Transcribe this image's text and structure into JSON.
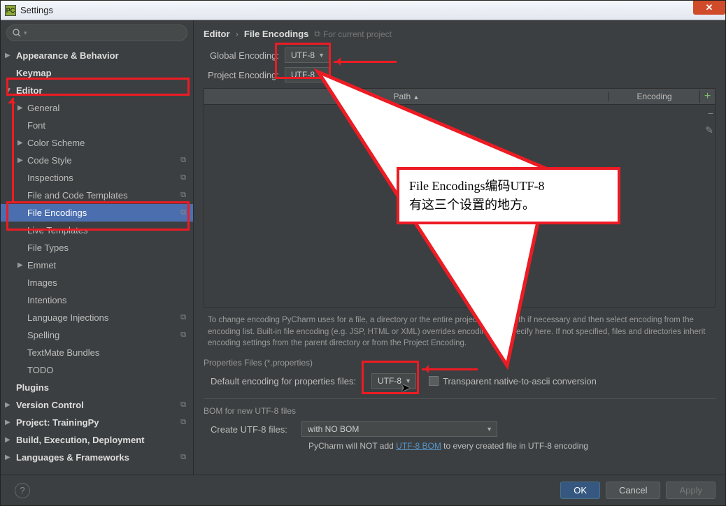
{
  "window": {
    "title": "Settings"
  },
  "search": {
    "placeholder": ""
  },
  "sidebar": {
    "items": [
      {
        "label": "Appearance & Behavior",
        "arrow": "▶",
        "lvl": 0,
        "bold": true
      },
      {
        "label": "Keymap",
        "lvl": 0,
        "bold": true
      },
      {
        "label": "Editor",
        "arrow": "▼",
        "lvl": 0,
        "bold": true
      },
      {
        "label": "General",
        "arrow": "▶",
        "lvl": 1
      },
      {
        "label": "Font",
        "lvl": 1
      },
      {
        "label": "Color Scheme",
        "arrow": "▶",
        "lvl": 1
      },
      {
        "label": "Code Style",
        "arrow": "▶",
        "lvl": 1,
        "copy": true
      },
      {
        "label": "Inspections",
        "lvl": 1,
        "copy": true
      },
      {
        "label": "File and Code Templates",
        "lvl": 1,
        "copy": true
      },
      {
        "label": "File Encodings",
        "lvl": 1,
        "copy": true,
        "selected": true
      },
      {
        "label": "Live Templates",
        "lvl": 1
      },
      {
        "label": "File Types",
        "lvl": 1
      },
      {
        "label": "Emmet",
        "arrow": "▶",
        "lvl": 1
      },
      {
        "label": "Images",
        "lvl": 1
      },
      {
        "label": "Intentions",
        "lvl": 1
      },
      {
        "label": "Language Injections",
        "lvl": 1,
        "copy": true
      },
      {
        "label": "Spelling",
        "lvl": 1,
        "copy": true
      },
      {
        "label": "TextMate Bundles",
        "lvl": 1
      },
      {
        "label": "TODO",
        "lvl": 1
      },
      {
        "label": "Plugins",
        "lvl": 0,
        "bold": true
      },
      {
        "label": "Version Control",
        "arrow": "▶",
        "lvl": 0,
        "bold": true,
        "copy": true
      },
      {
        "label": "Project: TrainingPy",
        "arrow": "▶",
        "lvl": 0,
        "bold": true,
        "copy": true
      },
      {
        "label": "Build, Execution, Deployment",
        "arrow": "▶",
        "lvl": 0,
        "bold": true
      },
      {
        "label": "Languages & Frameworks",
        "arrow": "▶",
        "lvl": 0,
        "bold": true,
        "copy": true
      }
    ]
  },
  "breadcrumb": {
    "a": "Editor",
    "b": "File Encodings",
    "proj": "For current project"
  },
  "encoding": {
    "globalLabel": "Global Encoding:",
    "globalValue": "UTF-8",
    "projectLabel": "Project Encoding:",
    "projectValue": "UTF-8",
    "tableHeaders": {
      "path": "Path",
      "enc": "Encoding"
    },
    "helptext": "To change encoding PyCharm uses for a file, a directory or the entire project, add its path if necessary and then select encoding from the encoding list. Built-in file encoding (e.g. JSP, HTML or XML) overrides encoding you specify here. If not specified, files and directories inherit encoding settings from the parent directory or from the Project Encoding.",
    "propsSection": "Properties Files (*.properties)",
    "propsLabel": "Default encoding for properties files:",
    "propsValue": "UTF-8",
    "transparentLabel": "Transparent native-to-ascii conversion",
    "bomSection": "BOM for new UTF-8 files",
    "bomLabel": "Create UTF-8 files:",
    "bomValue": "with NO BOM",
    "bomNote1": "PyCharm will NOT add ",
    "bomLink": "UTF-8 BOM",
    "bomNote2": " to every created file in UTF-8 encoding"
  },
  "footer": {
    "ok": "OK",
    "cancel": "Cancel",
    "apply": "Apply"
  },
  "annotation": {
    "callout_line1": "File  Encodings编码UTF-8",
    "callout_line2": "有这三个设置的地方。"
  }
}
